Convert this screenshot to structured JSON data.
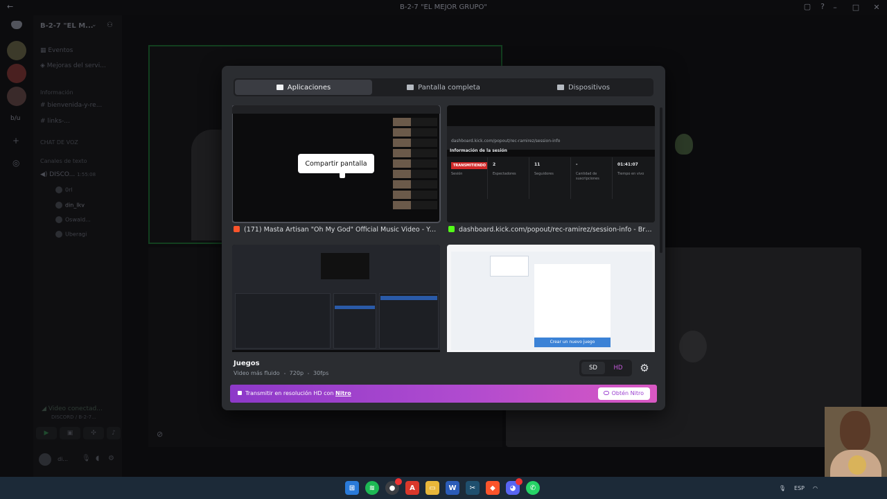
{
  "window": {
    "title": "B-2-7 \"EL MEJOR GRUPO\""
  },
  "server": {
    "name": "B-2-7 \"EL M...",
    "rail_label": "b/u"
  },
  "channels": {
    "items": [
      {
        "label": "Eventos"
      },
      {
        "label": "Mejoras del servi..."
      },
      {
        "label": "bienvenida-y-re..."
      },
      {
        "label": "links-..."
      },
      {
        "label": "DISCO..."
      }
    ],
    "categories": [
      "Información",
      "CHAT DE VOZ",
      "Canales de texto"
    ],
    "voice_timer": "1:55:08",
    "voice_users": [
      "0rl",
      "din_lkv",
      "Oswald...",
      "Uberagi"
    ]
  },
  "voice_panel": {
    "status": "Video conectad...",
    "location": "DISCORD / B-2-7..."
  },
  "user": {
    "name": "di..."
  },
  "picker": {
    "tabs": [
      {
        "label": "Aplicaciones",
        "active": true
      },
      {
        "label": "Pantalla completa",
        "active": false
      },
      {
        "label": "Dispositivos",
        "active": false
      }
    ],
    "sources": [
      {
        "label": "(171) Masta Artisan \"Oh My God\" Official Music Video - YouTube - Br...",
        "icon": "brave-icon"
      },
      {
        "label": "dashboard.kick.com/popout/rec-ramirez/session-info - Brave",
        "icon": "kick-icon"
      },
      {
        "label": "",
        "icon": "obs-icon"
      },
      {
        "label": "",
        "icon": "browser-icon"
      }
    ],
    "share_button": "Compartir pantalla",
    "kick_thumb": {
      "url": "dashboard.kick.com/popout/rec-ramirez/session-info",
      "heading": "Información de la sesión",
      "live_badge": "TRANSMITIENDO",
      "session_label": "Sesión",
      "stats": [
        {
          "value": "2",
          "label": "Espectadores"
        },
        {
          "value": "11",
          "label": "Seguidores"
        },
        {
          "value": "-",
          "label": "Cantidad de suscripciones"
        },
        {
          "value": "01:41:07",
          "label": "Tiempo en vivo"
        }
      ]
    },
    "web_thumb": {
      "button": "Crear un nuevo juego"
    },
    "activity_title": "Juegos",
    "meta": {
      "mode": "Video más fluido",
      "resolution": "720p",
      "fps": "30fps"
    },
    "quality": {
      "sd": "SD",
      "hd": "HD"
    },
    "nitro": {
      "message": "Transmitir en resolución HD con",
      "link": "Nitro",
      "button": "Obtén Nitro"
    }
  },
  "tray": {
    "language": "ESP"
  },
  "colors": {
    "accent_hd": "#c85be0",
    "nitro_gradient_start": "#8d39c9",
    "nitro_gradient_end": "#d958c3",
    "live_red": "#d12a2a",
    "speaking_green": "#123f1f"
  }
}
